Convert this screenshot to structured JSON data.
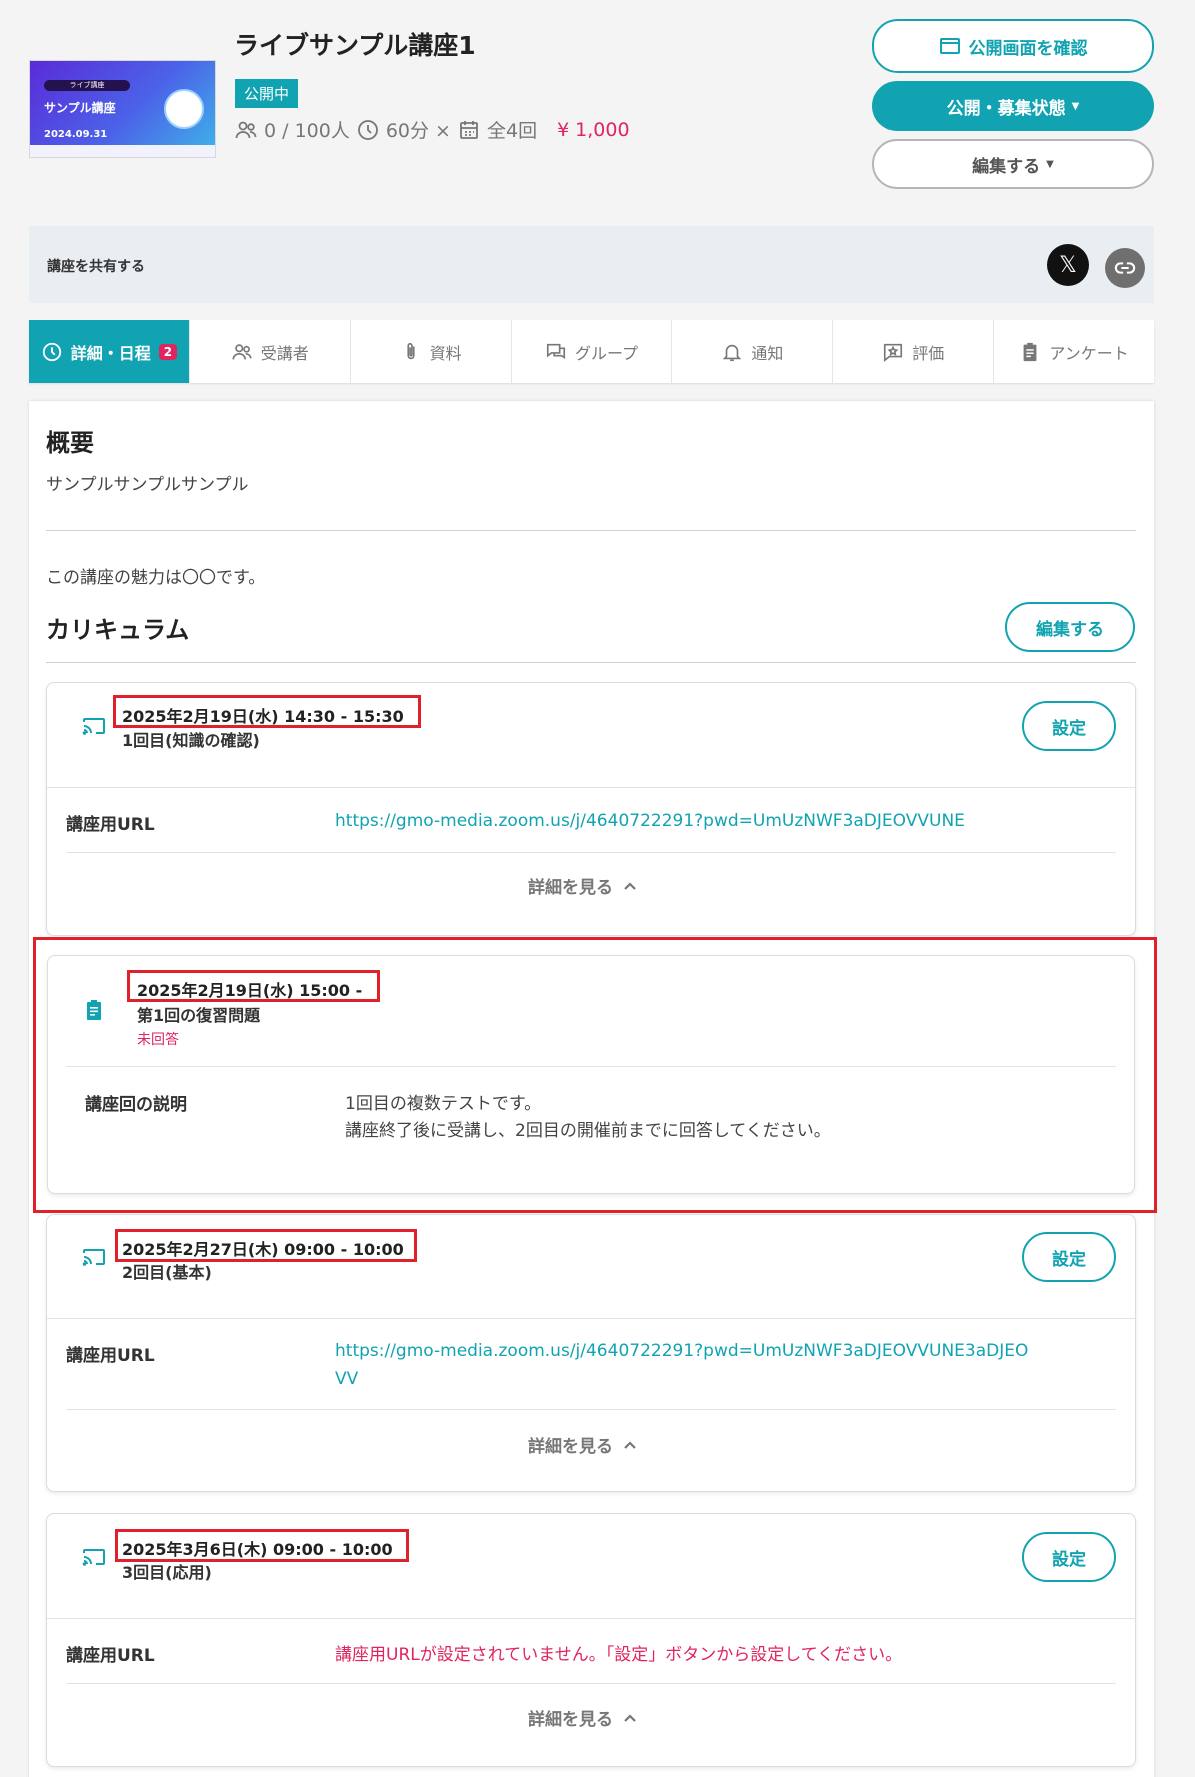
{
  "course": {
    "title": "ライブサンプル講座1",
    "status_badge": "公開中",
    "participants": "0 / 100人",
    "duration": "60分 ×",
    "sessions": "全4回",
    "price": "1,000",
    "thumbnail": {
      "tag": "ライブ講座",
      "heading": "サンプル講座",
      "date": "2024.09.31"
    }
  },
  "actions": {
    "preview": "公開画面を確認",
    "publish_state": "公開・募集状態",
    "edit": "編集する"
  },
  "share": {
    "label": "講座を共有する",
    "x_symbol": "𝕏"
  },
  "tabs": [
    {
      "label": "詳細・日程",
      "count": "2"
    },
    {
      "label": "受講者"
    },
    {
      "label": "資料"
    },
    {
      "label": "グループ"
    },
    {
      "label": "通知"
    },
    {
      "label": "評価"
    },
    {
      "label": "アンケート"
    }
  ],
  "overview": {
    "heading": "概要",
    "text": "サンプルサンプルサンプル",
    "charm": "この講座の魅力は〇〇です。"
  },
  "curriculum": {
    "heading": "カリキュラム",
    "edit_button": "編集する",
    "url_label": "講座用URL",
    "settings_button": "設定",
    "more_label": "詳細を見る",
    "items": [
      {
        "date": "2025年2月19日(水) 14:30 - 15:30",
        "name": "1回目(知識の確認)",
        "url": "https://gmo-media.zoom.us/j/4640722291?pwd=UmUzNWF3aDJEOVVUNE"
      },
      {
        "date": "2025年2月19日(水) 15:00 -",
        "name": "第1回の復習問題",
        "status": "未回答",
        "desc_label": "講座回の説明",
        "desc_line1": "1回目の複数テストです。",
        "desc_line2": "講座終了後に受講し、2回目の開催前までに回答してください。"
      },
      {
        "date": "2025年2月27日(木) 09:00 - 10:00",
        "name": "2回目(基本)",
        "url_line1": "https://gmo-media.zoom.us/j/4640722291?pwd=UmUzNWF3aDJEOVVUNE3aDJEO",
        "url_line2": "VV"
      },
      {
        "date": "2025年3月6日(木) 09:00 - 10:00",
        "name": "3回目(応用)",
        "url_missing": "講座用URLが設定されていません。「設定」ボタンから設定してください。"
      }
    ]
  },
  "colors": {
    "accent": "#11a3b1",
    "alert": "#e0245e",
    "highlight_box": "#e0202a"
  }
}
